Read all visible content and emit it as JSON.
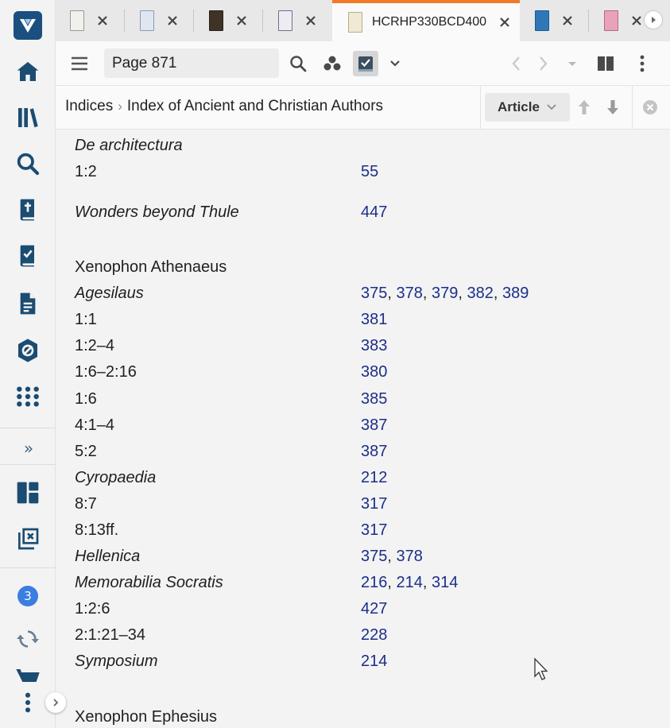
{
  "tabs": [
    {
      "title": ""
    },
    {
      "title": ""
    },
    {
      "title": ""
    },
    {
      "title": ""
    },
    {
      "title": "HCRHP330BCD400"
    },
    {
      "title": ""
    },
    {
      "title": ""
    }
  ],
  "toolbar": {
    "page_value": "Page 871"
  },
  "breadcrumb": {
    "root": "Indices",
    "current": "Index of Ancient and Christian Authors"
  },
  "article_button": {
    "label": "Article"
  },
  "rail": {
    "notification_count": "3"
  },
  "index_rows": [
    {
      "label": "De architectura",
      "italic": true,
      "refs": []
    },
    {
      "label": "1:2",
      "italic": false,
      "refs": [
        "55"
      ]
    },
    {
      "label": "Wonders beyond Thule",
      "italic": true,
      "refs": [
        "447"
      ]
    },
    {
      "label": "Xenophon Athenaeus",
      "italic": false,
      "refs": []
    },
    {
      "label": "Agesilaus",
      "italic": true,
      "refs": [
        "375",
        "378",
        "379",
        "382",
        "389"
      ]
    },
    {
      "label": "1:1",
      "italic": false,
      "refs": [
        "381"
      ]
    },
    {
      "label": "1:2–4",
      "italic": false,
      "refs": [
        "383"
      ]
    },
    {
      "label": "1:6–2:16",
      "italic": false,
      "refs": [
        "380"
      ]
    },
    {
      "label": "1:6",
      "italic": false,
      "refs": [
        "385"
      ]
    },
    {
      "label": "4:1–4",
      "italic": false,
      "refs": [
        "387"
      ]
    },
    {
      "label": "5:2",
      "italic": false,
      "refs": [
        "387"
      ]
    },
    {
      "label": "Cyropaedia",
      "italic": true,
      "refs": [
        "212"
      ]
    },
    {
      "label": "8:7",
      "italic": false,
      "refs": [
        "317"
      ]
    },
    {
      "label": "8:13ff.",
      "italic": false,
      "refs": [
        "317"
      ]
    },
    {
      "label": "Hellenica",
      "italic": true,
      "refs": [
        "375",
        "378"
      ]
    },
    {
      "label": "Memorabilia Socratis",
      "italic": true,
      "refs": [
        "216",
        "214",
        "314"
      ]
    },
    {
      "label": "1:2:6",
      "italic": false,
      "refs": [
        "427"
      ]
    },
    {
      "label": "2:1:21–34",
      "italic": false,
      "refs": [
        "228"
      ]
    },
    {
      "label": "Symposium",
      "italic": true,
      "refs": [
        "214"
      ]
    },
    {
      "label": "Xenophon Ephesius",
      "italic": false,
      "refs": []
    }
  ],
  "colors": {
    "accent_tab": "#f07a28",
    "link": "#1c2e8a",
    "rail_icon": "#1b4c72",
    "badge": "#3b7de1"
  }
}
